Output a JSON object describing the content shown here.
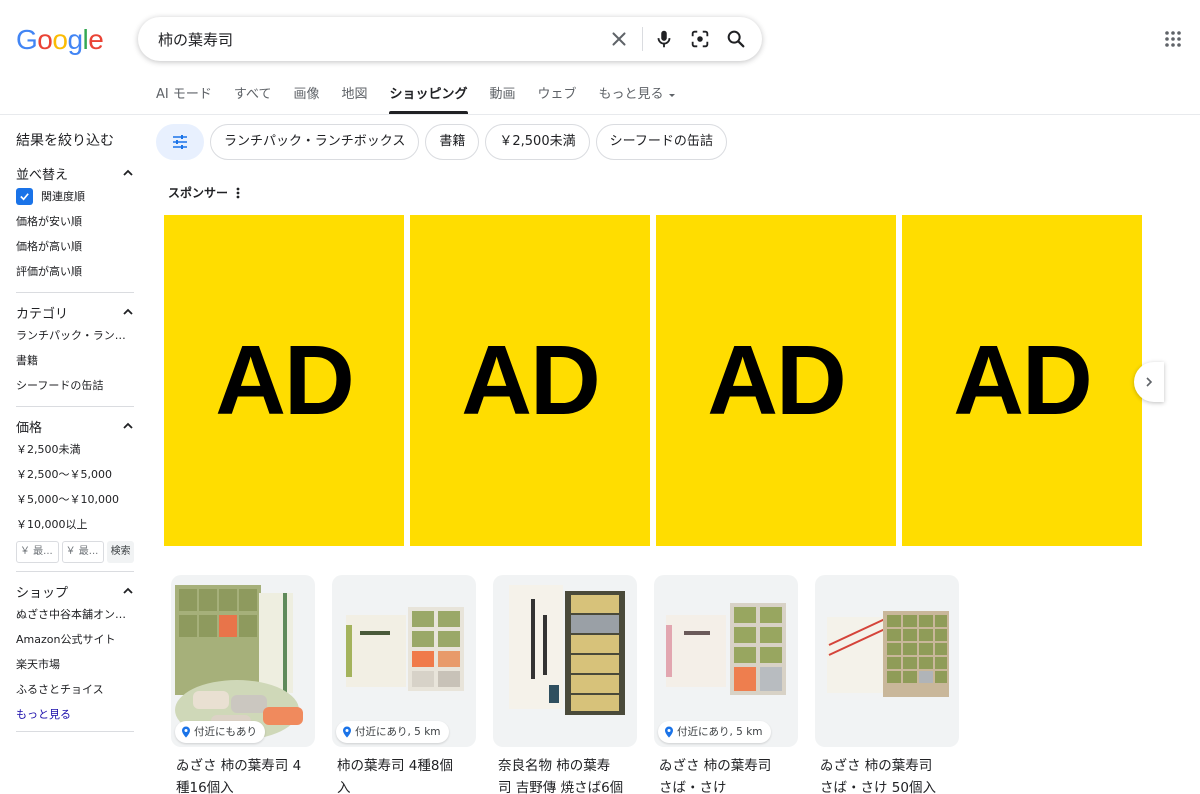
{
  "search": {
    "query": "柿の葉寿司"
  },
  "tabs": [
    {
      "label": "AI モード"
    },
    {
      "label": "すべて"
    },
    {
      "label": "画像"
    },
    {
      "label": "地図"
    },
    {
      "label": "ショッピング",
      "active": true
    },
    {
      "label": "動画"
    },
    {
      "label": "ウェブ"
    },
    {
      "label": "もっと見る"
    }
  ],
  "sidebar": {
    "title": "結果を絞り込む",
    "sort": {
      "heading": "並べ替え",
      "items": [
        "関連度順",
        "価格が安い順",
        "価格が高い順",
        "評価が高い順"
      ]
    },
    "category": {
      "heading": "カテゴリ",
      "items": [
        "ランチパック・ランチボックス",
        "書籍",
        "シーフードの缶詰"
      ]
    },
    "price": {
      "heading": "価格",
      "items": [
        "￥2,500未満",
        "￥2,500〜￥5,000",
        "￥5,000〜￥10,000",
        "￥10,000以上"
      ],
      "min_placeholder": "￥ 最...",
      "max_placeholder": "￥ 最...",
      "button": "検索"
    },
    "shop": {
      "heading": "ショップ",
      "items": [
        "ぬざさ中谷本舗オン…",
        "Amazon公式サイト",
        "楽天市場",
        "ふるさとチョイス"
      ],
      "more": "もっと見る"
    }
  },
  "chips": [
    "ランチパック・ランチボックス",
    "書籍",
    "￥2,500未満",
    "シーフードの缶詰"
  ],
  "sponsor_label": "スポンサー",
  "ads": [
    "AD",
    "AD",
    "AD",
    "AD"
  ],
  "products": [
    {
      "badge": "付近にもあり",
      "title_line1": "ゐざさ 柿の葉寿司 4",
      "title_line2": "種16個入"
    },
    {
      "badge": "付近にあり, 5 km",
      "title_line1": "柿の葉寿司 4種8個",
      "title_line2": "入"
    },
    {
      "badge": "",
      "title_line1": "奈良名物 柿の葉寿",
      "title_line2": "司 吉野傳 焼さば6個"
    },
    {
      "badge": "付近にあり, 5 km",
      "title_line1": "ゐざさ 柿の葉寿司",
      "title_line2": "さば・さけ"
    },
    {
      "badge": "",
      "title_line1": "ゐざさ 柿の葉寿司",
      "title_line2": "さば・さけ 50個入"
    }
  ],
  "colors": {
    "accent": "#1a73e8",
    "ad_bg": "#ffdd00",
    "link": "#1a0dab"
  }
}
